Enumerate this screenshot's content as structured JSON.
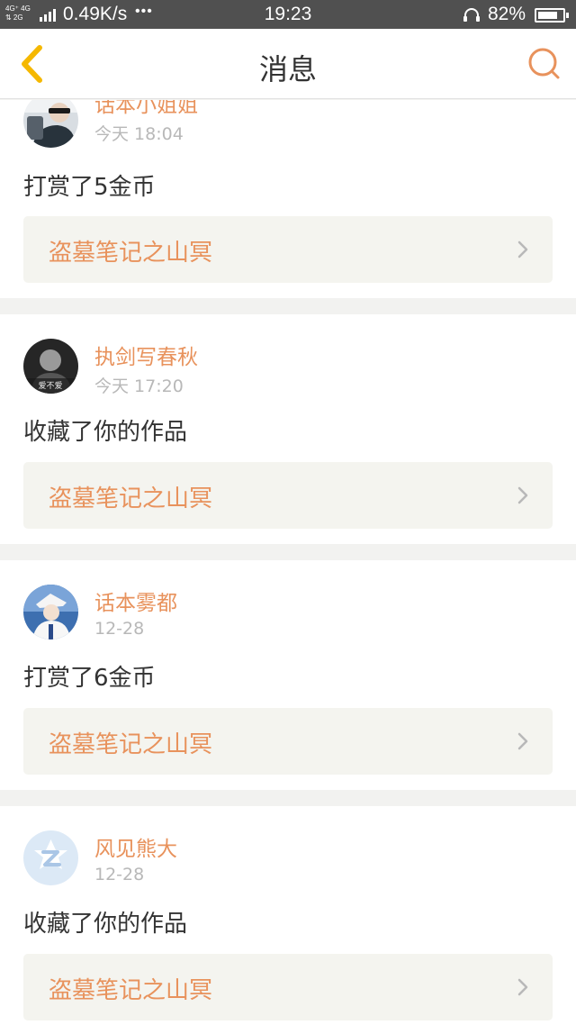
{
  "status_bar": {
    "network_top": "4G⁺ 4G",
    "network_bottom": "⇅ 2G",
    "speed": "0.49K/s",
    "more_dots": "•••",
    "time": "19:23",
    "battery_percent": "82%",
    "battery_level": 0.82,
    "icons": [
      "signal-icon",
      "headphone-icon",
      "battery-icon"
    ]
  },
  "header": {
    "title": "消息",
    "back_icon": "chevron-left-icon",
    "search_icon": "search-icon"
  },
  "colors": {
    "accent": "#e8925c",
    "back_arrow": "#f5b800",
    "status_bar_bg": "#505050",
    "page_bg": "#f2f2f0",
    "link_bg": "#f4f4ef"
  },
  "messages": [
    {
      "user": "话本小姐姐",
      "time": "今天 18:04",
      "action": "打赏了5金币",
      "work": "盗墓笔记之山冥"
    },
    {
      "user": "执剑写春秋",
      "time": "今天 17:20",
      "action": "收藏了你的作品",
      "work": "盗墓笔记之山冥",
      "avatar_caption": "爱不爱"
    },
    {
      "user": "话本雾都",
      "time": "12-28",
      "action": "打赏了6金币",
      "work": "盗墓笔记之山冥"
    },
    {
      "user": "风见熊大",
      "time": "12-28",
      "action": "收藏了你的作品",
      "work": "盗墓笔记之山冥"
    }
  ]
}
